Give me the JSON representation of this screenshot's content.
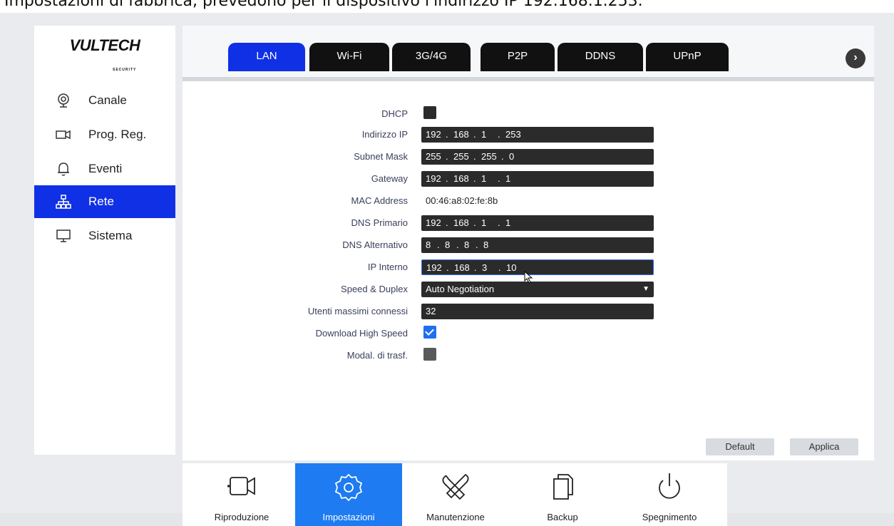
{
  "caption": "Impostazioni di fabbrica, prevedono per il dispositivo l'indirizzo IP 192.168.1.253.",
  "brand": {
    "logo": "VULTECH",
    "sub": "SECURITY"
  },
  "sidebar": {
    "items": [
      {
        "label": "Canale",
        "icon": "camera-icon"
      },
      {
        "label": "Prog. Reg.",
        "icon": "video-icon"
      },
      {
        "label": "Eventi",
        "icon": "bell-icon"
      },
      {
        "label": "Rete",
        "icon": "network-icon",
        "active": true
      },
      {
        "label": "Sistema",
        "icon": "monitor-icon"
      }
    ]
  },
  "tabs": [
    {
      "label": "LAN",
      "active": true
    },
    {
      "label": "Wi-Fi"
    },
    {
      "label": "3G/4G"
    },
    {
      "label": "P2P"
    },
    {
      "label": "DDNS"
    },
    {
      "label": "UPnP"
    }
  ],
  "form": {
    "dhcp_label": "DHCP",
    "ip_label": "Indirizzo IP",
    "ip": [
      "192",
      "168",
      "1",
      "253"
    ],
    "subnet_label": "Subnet Mask",
    "subnet": [
      "255",
      "255",
      "255",
      "0"
    ],
    "gateway_label": "Gateway",
    "gateway": [
      "192",
      "168",
      "1",
      "1"
    ],
    "mac_label": "MAC Address",
    "mac": "00:46:a8:02:fe:8b",
    "dns1_label": "DNS Primario",
    "dns1": [
      "192",
      "168",
      "1",
      "1"
    ],
    "dns2_label": "DNS Alternativo",
    "dns2": [
      "8",
      "8",
      "8",
      "8"
    ],
    "internal_label": "IP Interno",
    "internal": [
      "192",
      "168",
      "3",
      "10"
    ],
    "speed_label": "Speed & Duplex",
    "speed_value": "Auto Negotiation",
    "max_users_label": "Utenti massimi connessi",
    "max_users": "32",
    "download_label": "Download High Speed",
    "transfer_label": "Modal. di trasf."
  },
  "buttons": {
    "default": "Default",
    "apply": "Applica"
  },
  "dock": [
    {
      "label": "Riproduzione",
      "icon": "playback-camera-icon"
    },
    {
      "label": "Impostazioni",
      "icon": "settings-gear-icon",
      "active": true
    },
    {
      "label": "Manutenzione",
      "icon": "tools-icon"
    },
    {
      "label": "Backup",
      "icon": "documents-icon"
    },
    {
      "label": "Spegnimento",
      "icon": "power-icon"
    }
  ],
  "colors": {
    "accent": "#1030e6",
    "dock_active": "#1e7bf2",
    "field_bg": "#2b2b2b"
  }
}
